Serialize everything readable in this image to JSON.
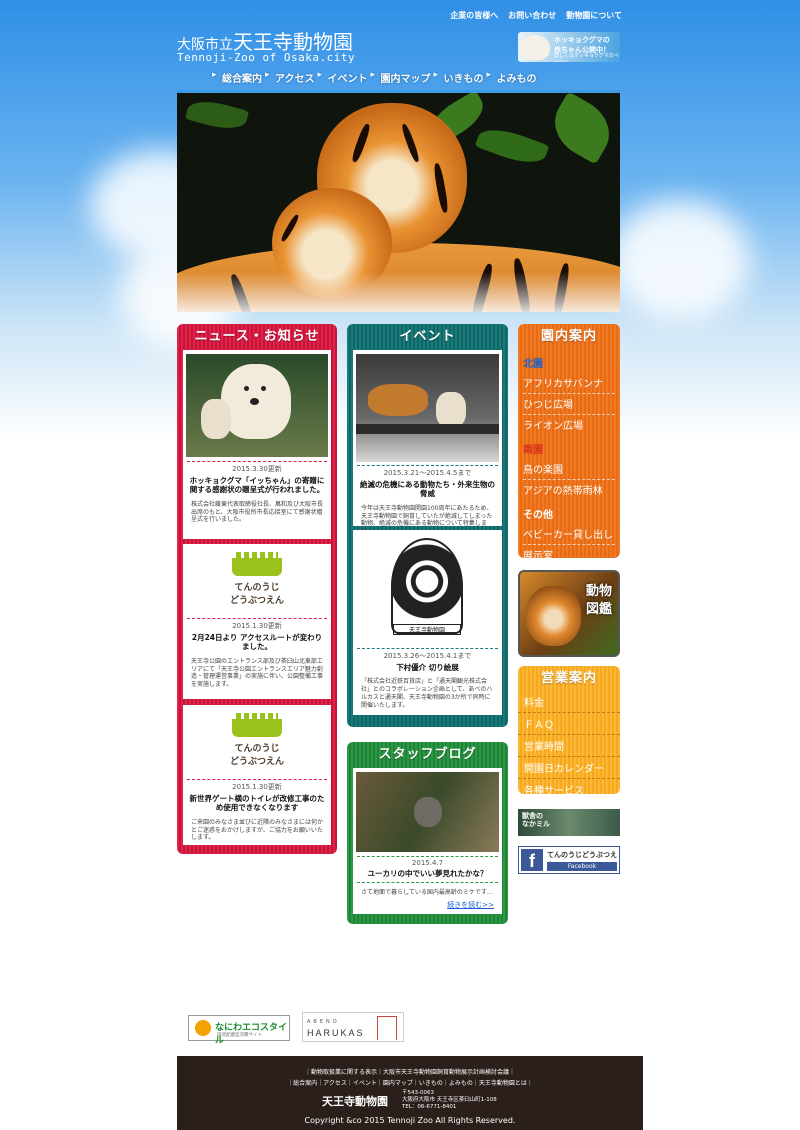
{
  "topnav": [
    "企業の皆様へ",
    "お問い合わせ",
    "動物園について"
  ],
  "logo": {
    "prefix": "大阪市立",
    "name": "天王寺動物園",
    "en": "Tennoji-Zoo of Osaka.city"
  },
  "banner_top": {
    "line1": "ホッキョクグマの",
    "line2": "赤ちゃん公開中！",
    "line3": "詳しくはホッキョクグマのページへ"
  },
  "gnav": [
    "総合案内",
    "アクセス",
    "イベント",
    "園内マップ",
    "いきもの",
    "よみもの"
  ],
  "news": {
    "title": "ニュース・お知らせ",
    "items": [
      {
        "date": "2015.3.30更新",
        "title": "ホッキョクグマ「イッちゃん」の寄贈に関する感謝状の贈呈式が行われました。",
        "body": "株式会社藤東代表取締役社長、萬和及び大阪市長出席のもと、大阪市役所市長応接室にて感謝状贈呈式を行いました。"
      },
      {
        "logo1": "てんのうじ",
        "logo2": "どうぶつえん",
        "date": "2015.1.30更新",
        "title": "2月24日より アクセスルートが変わりました。",
        "body": "天王寺公園のエントランス部及び茶臼山北東部エリアにて「天王寺公園エントランスエリア魅力創造・管理運営事業」の実施に伴い、公園整備工事を実施します。"
      },
      {
        "logo1": "てんのうじ",
        "logo2": "どうぶつえん",
        "date": "2015.1.30更新",
        "title": "新世界ゲート横のトイレが改修工事のため使用できなくなります",
        "body": "ご来園のみなさま並びに近隣のみなさまには何かとご迷惑をおかけしますが、ご協力をお願いいたします。"
      }
    ]
  },
  "events": {
    "title": "イベント",
    "items": [
      {
        "date": "2015.3.21～2015.4.5まで",
        "title": "絶滅の危機にある動物たち・外来生物の脅威",
        "body": "今年は天王寺動物園開園100周年にあたるため、天王寺動物園で飼育していたが絶滅してしまった動物、絶滅の危機にある動物について特集します。"
      },
      {
        "stamp": "天王寺動物園",
        "date": "2015.3.26～2015.4.1まで",
        "title": "下村優介 切り絵展",
        "body": "「株式会社近鉄百貨店」と「通天閣観光株式会社」とのコラボレーション企画として、あべのハルカスと通天閣、天王寺動物園の3か所で同時に開催いたします。"
      }
    ]
  },
  "blog": {
    "title": "スタッフブログ",
    "date": "2015.4.7",
    "heading": "ユーカリの中でいい夢見れたかな？",
    "body": "さて地面で暮らしている国内最高齢のミケです…",
    "more": "続きを読む>>"
  },
  "guide": {
    "title": "園内案内",
    "groups": [
      {
        "head": "北園",
        "links": [
          "アフリカサバンナ",
          "ひつじ広場",
          "ライオン広場"
        ]
      },
      {
        "head": "南園",
        "links": [
          "鳥の楽園",
          "アジアの熱帯雨林"
        ]
      },
      {
        "head": "その他",
        "links": [
          "ベビーカー貸し出し",
          "展示室"
        ]
      }
    ]
  },
  "zukan": {
    "t1": "動物",
    "t2": "図鑑"
  },
  "business": {
    "title": "営業案内",
    "links": [
      "料金",
      "ＦＡＱ",
      "営業時間",
      "開園日カレンダー",
      "各種サービス"
    ]
  },
  "webcam": {
    "t1": "獣舎の",
    "t2": "なかミル"
  },
  "facebook": {
    "name": "てんのうじどうぶつえん",
    "label": "Facebook"
  },
  "banners": {
    "eco_main": "なにわエコスタイル",
    "eco_sub": "環境配慮型消費サイト",
    "abeno": "ABENO",
    "harukas": "HARUKAS"
  },
  "footer": {
    "links1": "｜動物取扱業に関する表示｜大阪市天王寺動物園飼育動物展示計画検討会議｜",
    "links2": "｜総合案内｜アクセス｜イベント｜園内マップ｜いきもの｜よみもの｜天王寺動物園とは｜",
    "name": "天王寺動物園",
    "zip": "〒543-0063",
    "address": "大阪府大阪市 天王寺区茶臼山町1-108",
    "tel": "TEL：06-6771-8401",
    "copyright": "Copyright &co 2015 Tennoji Zoo All Rights Reserved."
  }
}
